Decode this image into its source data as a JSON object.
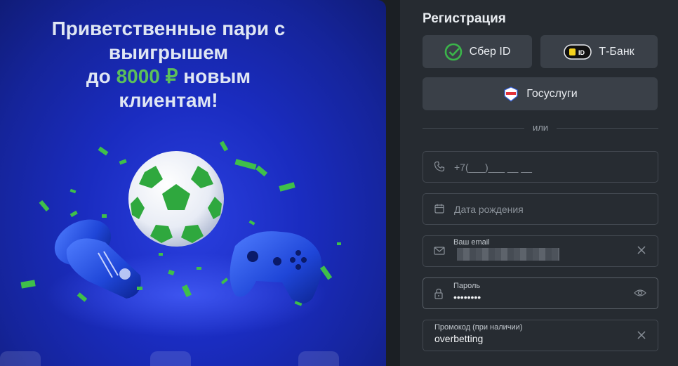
{
  "promo": {
    "title_line1": "Приветственные пари с",
    "title_line2": "выигрышем",
    "title_prefix3": "до",
    "title_amount": "8000 ₽",
    "title_suffix3": "новым",
    "title_line4": "клиентам!"
  },
  "registration": {
    "title": "Регистрация",
    "sber_label": "Сбер ID",
    "tbank_label": "Т-Банк",
    "gosuslugi_label": "Госуслуги",
    "separator": "или",
    "phone_placeholder": "+7(___)___ __ __",
    "birthdate_placeholder": "Дата рождения",
    "email_label": "Ваш email",
    "password_label": "Пароль",
    "password_value": "••••••••",
    "promocode_label": "Промокод (при наличии)",
    "promocode_value": "overbetting"
  },
  "icons": {
    "sber": "sber-check-icon",
    "tbank": "tbank-id-icon",
    "gosuslugi": "gosuslugi-shield-icon",
    "phone": "phone-icon",
    "calendar": "calendar-icon",
    "email": "envelope-icon",
    "password": "lock-icon",
    "clear": "close-icon",
    "show_password": "eye-icon"
  },
  "colors": {
    "accent_green": "#5cbf5a",
    "panel_bg": "#262b31",
    "button_bg": "#3a4048",
    "promo_blue": "#1a2cc0"
  }
}
